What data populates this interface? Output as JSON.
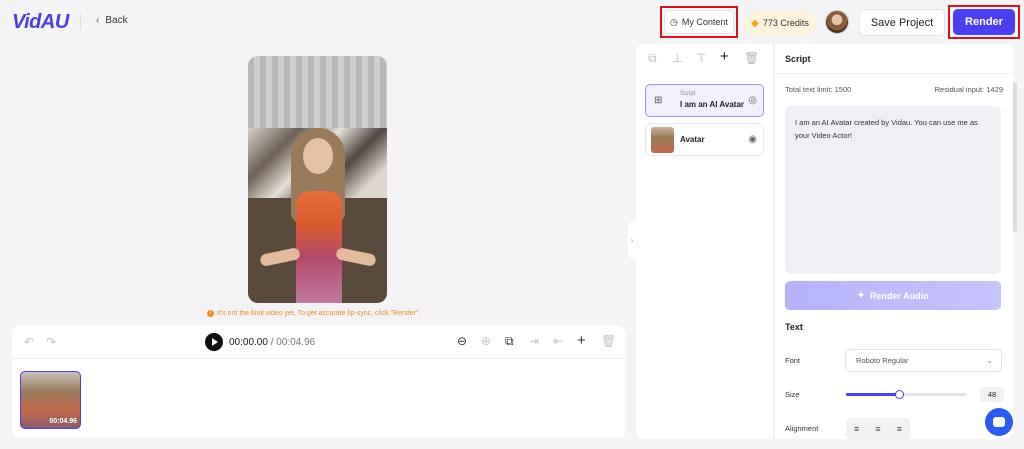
{
  "header": {
    "logo": "VidAU",
    "back_label": "Back",
    "my_content_label": "My Content",
    "credits_label": "773 Credits",
    "save_label": "Save Project",
    "render_label": "Render"
  },
  "preview": {
    "notice": "It's not the final video yet, To get accurate lip-sync, click \"Render\"."
  },
  "timeline": {
    "current_time": "00:00.00",
    "separator": "/",
    "total_time": "00:04.96",
    "clip_duration": "00:04.96"
  },
  "layers": {
    "items": [
      {
        "type_label": "Script",
        "title": "I am an AI Avatar created by Vidau.",
        "icon": "script-icon",
        "visible": true
      },
      {
        "title": "Avatar",
        "icon": "avatar-thumbnail",
        "visible": true
      }
    ]
  },
  "script_panel": {
    "title": "Script",
    "total_limit": "Total text limit: 1500",
    "residual": "Residual input: 1429",
    "script_text": "I am an AI Avatar created by Vidau. You can use me as your Video Actor!",
    "render_audio_label": "Render Audio",
    "text_section": "Text",
    "font_label": "Font",
    "font_value": "Roboto Regular",
    "size_label": "Size",
    "size_value": "48",
    "size_fraction": 0.44,
    "alignment_label": "Alignment"
  },
  "colors": {
    "accent": "#4b3ff0",
    "notice": "#f08a18",
    "highlight_box": "#d6141e",
    "credits_bg": "#fdf3dd"
  }
}
